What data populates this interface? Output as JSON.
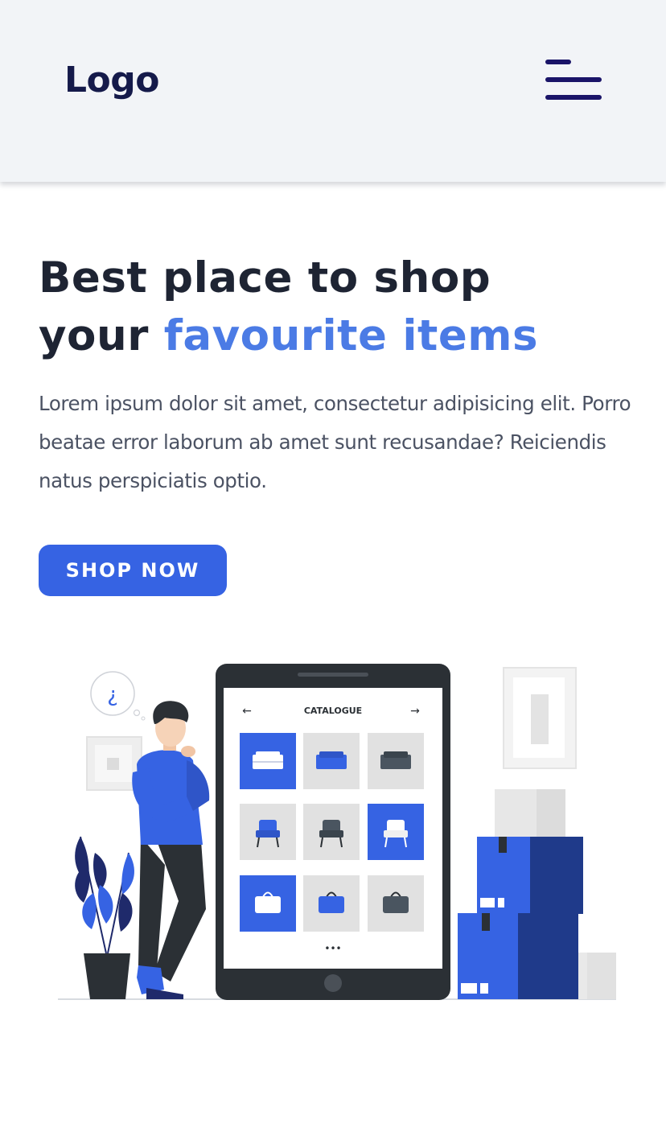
{
  "header": {
    "logo": "Logo",
    "menu_icon": "hamburger-menu-icon"
  },
  "hero": {
    "title_line1": "Best place to shop",
    "title_line2_plain": "your",
    "title_line2_accent": "favourite items",
    "description": "Lorem ipsum dolor sit amet, consectetur adipisicing elit. Porro beatae error laborum ab amet sunt recusandae? Reiciendis natus perspiciatis optio.",
    "cta_label": "SHOP NOW"
  },
  "illustration": {
    "thought_bubble_symbol": "¿",
    "screen_title": "CATALOGUE",
    "back_arrow": "←",
    "forward_arrow": "→",
    "more_indicator": "•••",
    "product_icons": [
      "sofa-icon",
      "sofa-icon",
      "sofa-icon",
      "armchair-icon",
      "armchair-icon",
      "armchair-icon",
      "bag-icon",
      "bag-icon",
      "bag-icon"
    ]
  },
  "colors": {
    "header_bg": "#f2f4f7",
    "logo": "#151a4a",
    "menu_icon": "#1a1468",
    "heading": "#1e2433",
    "accent": "#4b7be5",
    "body_text": "#4b5263",
    "button_bg": "#3663e3",
    "button_text": "#ffffff"
  }
}
